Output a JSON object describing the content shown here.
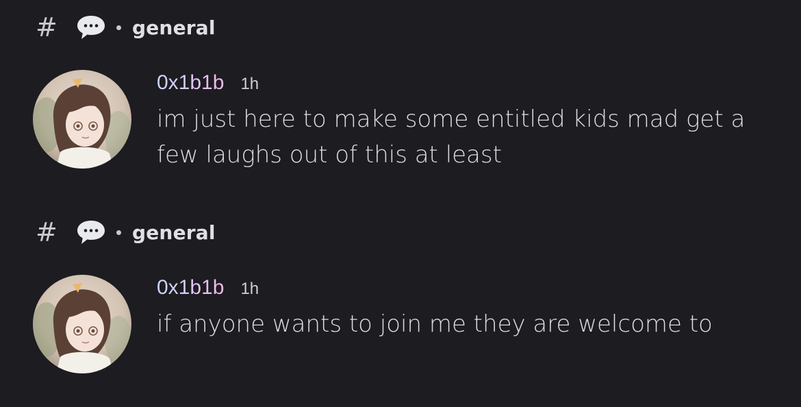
{
  "messages": [
    {
      "channel_prefix": "#",
      "channel_name": "general",
      "username": "0x1b1b",
      "timestamp": "1h",
      "text": "im just here to make some entitled kids mad get a few laughs out of this at least"
    },
    {
      "channel_prefix": "#",
      "channel_name": "general",
      "username": "0x1b1b",
      "timestamp": "1h",
      "text": "if anyone wants to join me they are welcome to"
    }
  ],
  "colors": {
    "background": "#1c1c21",
    "text": "#dcdde2",
    "username_gradient_start": "#c8d6ff",
    "username_gradient_end": "#f1b8e6"
  },
  "icons": {
    "channel": "hash-icon",
    "thread": "speech-bubble-icon",
    "separator": "dot-separator"
  }
}
